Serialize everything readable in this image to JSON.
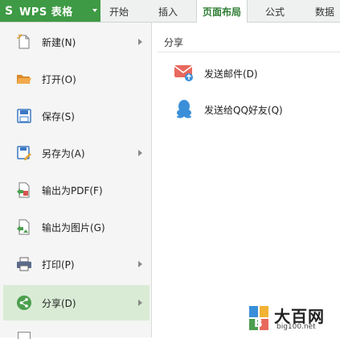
{
  "app": {
    "logo": "S",
    "title": "WPS 表格"
  },
  "ribbon_tabs": [
    {
      "label": "开始"
    },
    {
      "label": "插入"
    },
    {
      "label": "页面布局"
    },
    {
      "label": "公式"
    },
    {
      "label": "数据"
    }
  ],
  "active_tab_index": 2,
  "menu": {
    "items": [
      {
        "label": "新建(N)",
        "icon": "new-file-icon",
        "has_submenu": true
      },
      {
        "label": "打开(O)",
        "icon": "folder-open-icon",
        "has_submenu": false
      },
      {
        "label": "保存(S)",
        "icon": "save-icon",
        "has_submenu": false
      },
      {
        "label": "另存为(A)",
        "icon": "save-as-icon",
        "has_submenu": true
      },
      {
        "label": "输出为PDF(F)",
        "icon": "pdf-icon",
        "has_submenu": false
      },
      {
        "label": "输出为图片(G)",
        "icon": "image-export-icon",
        "has_submenu": false
      },
      {
        "label": "打印(P)",
        "icon": "printer-icon",
        "has_submenu": true
      },
      {
        "label": "分享(D)",
        "icon": "share-icon",
        "has_submenu": true,
        "selected": true
      }
    ]
  },
  "share_panel": {
    "title": "分享",
    "items": [
      {
        "label": "发送邮件(D)",
        "icon": "mail-icon"
      },
      {
        "label": "发送给QQ好友(Q)",
        "icon": "qq-icon"
      }
    ]
  },
  "watermark": {
    "text": "大百网",
    "url": "big100.net"
  },
  "colors": {
    "brand_green": "#3e9a44",
    "selected_bg": "#d9ebd5",
    "mail_red": "#e8695d",
    "qq_blue": "#3b8fd8"
  }
}
